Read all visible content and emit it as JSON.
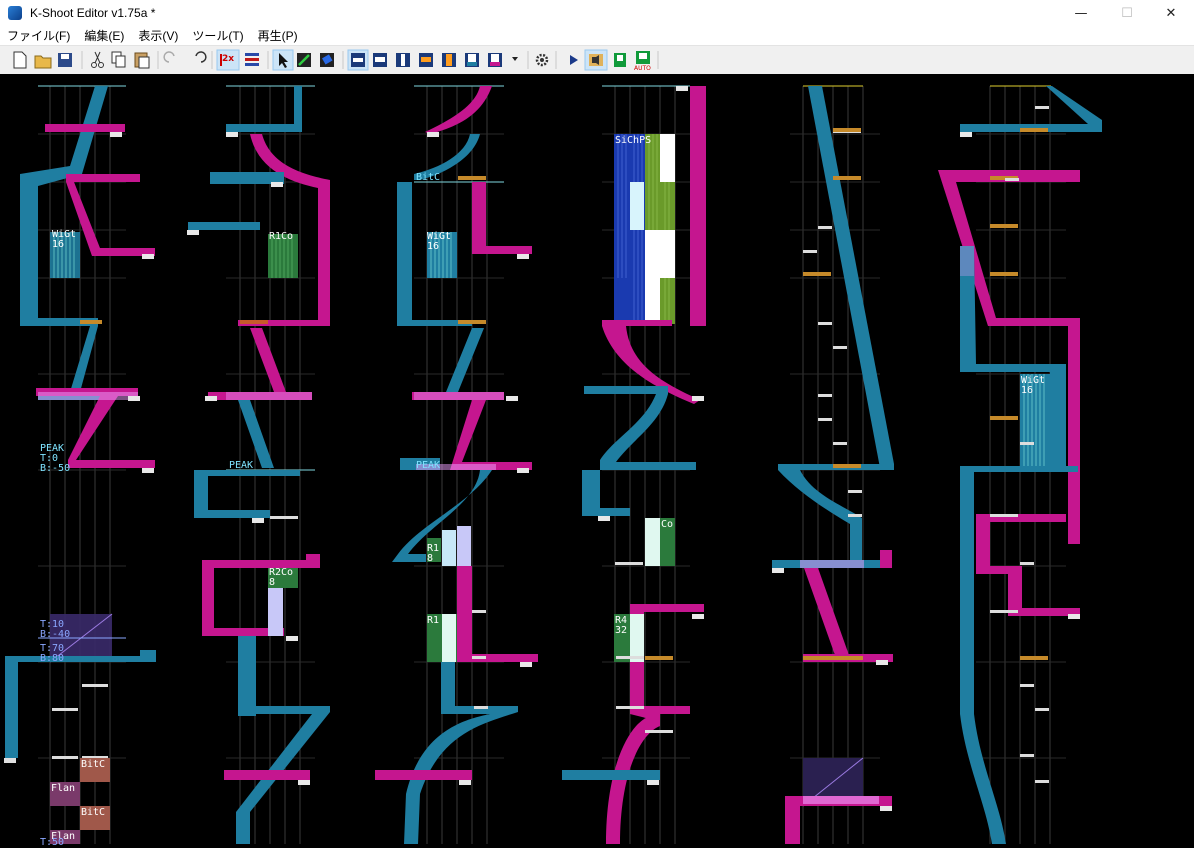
{
  "window": {
    "title": "K-Shoot Editor v1.75a *",
    "minimize_glyph": "—",
    "maximize_glyph": "☐",
    "close_glyph": "✕"
  },
  "menu": [
    "ファイル(F)",
    "編集(E)",
    "表示(V)",
    "ツール(T)",
    "再生(P)"
  ],
  "toolbar": {
    "icons": [
      "new-file-icon",
      "open-folder-icon",
      "save-icon",
      "cut-icon",
      "copy-icon",
      "paste-icon",
      "undo-icon",
      "redo-icon",
      "zoom-2x-icon",
      "bpm-tool-icon",
      "select-tool-icon",
      "draw-tool-icon",
      "eraser-tool-icon",
      "bt-note-icon",
      "fx-note-icon",
      "long-bt-icon",
      "long-fx-icon",
      "laser-left-icon",
      "laser-right-icon",
      "laser-slam-icon",
      "dropdown-icon",
      "settings-gear-icon",
      "play-icon",
      "play-sound-icon",
      "play-autoplay-icon",
      "autoplay-icon"
    ],
    "zoom_label": "2x",
    "auto_label": "AUTO",
    "colors": {
      "bt": "#ffffff",
      "fx": "#ff9d1e",
      "laser_left": "#1f7ea1",
      "laser_right": "#c5168f",
      "accent": "#1b68c8"
    }
  },
  "chart_labels": {
    "wigt16_a": "WiGt\n16",
    "peak_block": "PEAK\nT:0\nB:-50",
    "filter_a": "T:10\nB:-40",
    "filter_b": "T:70\nB:80",
    "bitc_a": "BitC",
    "flan_a": "Flan",
    "bitc_b": "BitC",
    "flan_b": "Flan",
    "t_bottom": "T:50",
    "r1co_a": "R1Co",
    "peak_2": "PEAK",
    "r2co": "R2Co\n8",
    "bitc_3": "BitC",
    "wigt16_b": "WiGt\n16",
    "peak_3": "PEAK",
    "r1_8": "R1\n8",
    "r1_3": "R1",
    "sichps": "SiChPS",
    "co_4": "Co",
    "r4_32": "R4\n32",
    "wigt16_c": "WiGt\n16"
  },
  "label_colors": {
    "white": "#ffffff",
    "cyan": "#7fe3ff",
    "blue": "#8aa7ff",
    "orange": "#ff7a3a"
  }
}
